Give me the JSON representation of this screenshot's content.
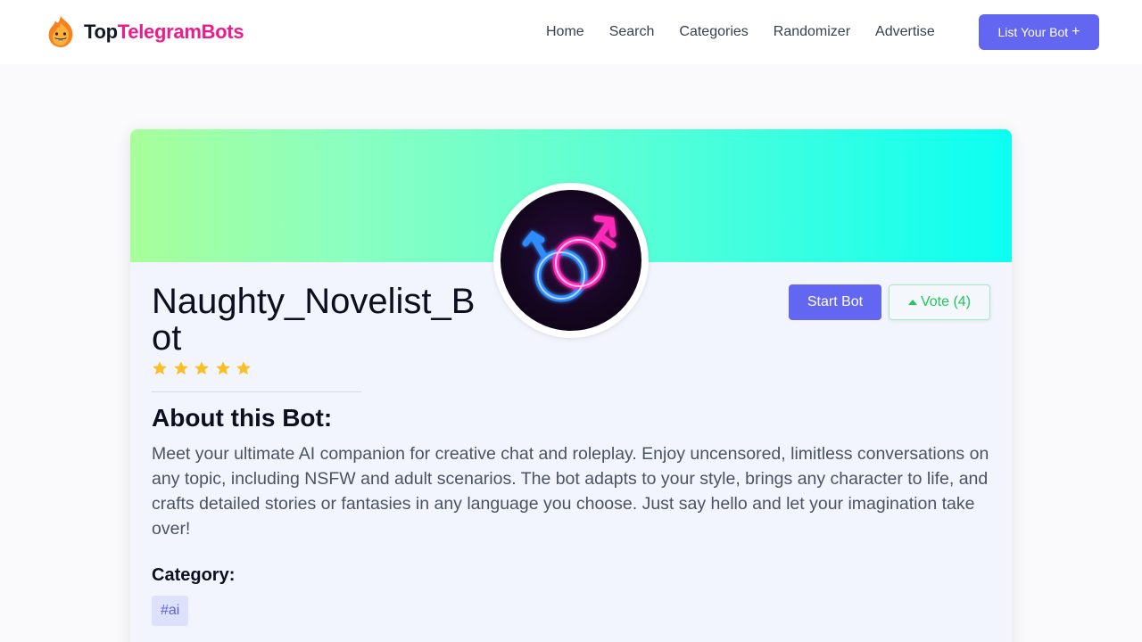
{
  "header": {
    "logo": {
      "top": "Top",
      "rest": "TelegramBots"
    },
    "nav": [
      "Home",
      "Search",
      "Categories",
      "Randomizer",
      "Advertise"
    ],
    "cta_label": "List Your Bot"
  },
  "bot": {
    "name": "Naughty_Novelist_Bot",
    "rating_stars": 5,
    "start_label": "Start Bot",
    "vote_label": "Vote (4)",
    "about_title": "About this Bot:",
    "about_text": "Meet your ultimate AI companion for creative chat and roleplay. Enjoy uncensored, limitless conversations on any topic, including NSFW and adult scenarios. The bot adapts to your style, brings any character to life, and crafts detailed stories or fantasies in any language you choose. Just say hello and let your imagination take over!",
    "category_title": "Category:",
    "category_tag": "#ai"
  },
  "colors": {
    "brand_pink": "#ec1c8c",
    "accent": "#6366f1",
    "vote_green": "#22c55e",
    "star": "#fbbf24"
  }
}
